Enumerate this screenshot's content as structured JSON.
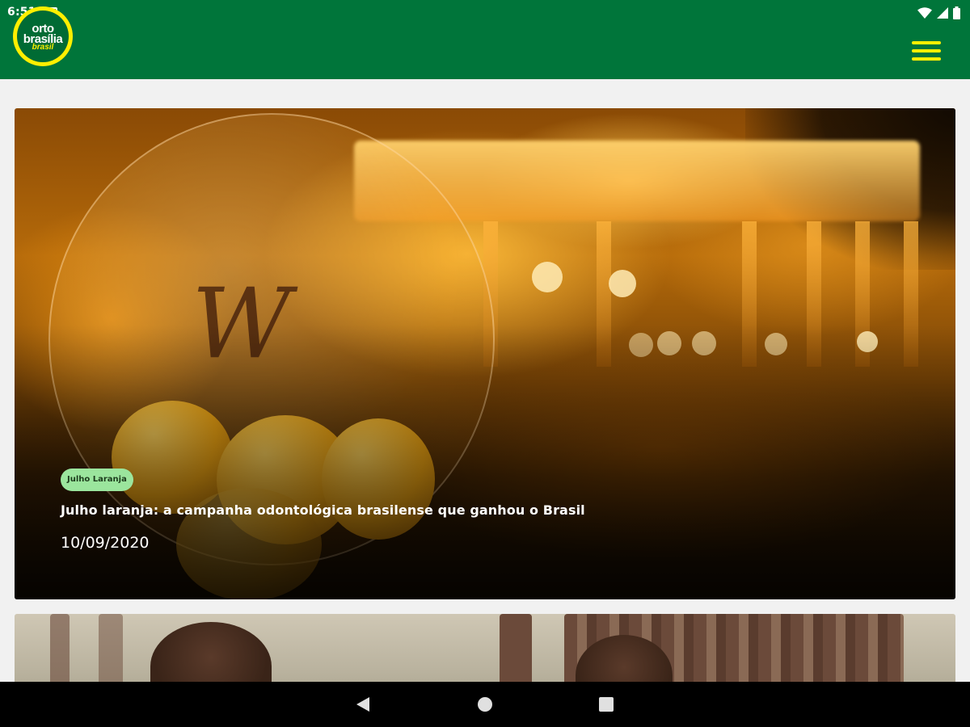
{
  "status_bar": {
    "time": "6:51",
    "icons": [
      "notification-icon",
      "wifi-icon",
      "signal-icon",
      "battery-icon"
    ]
  },
  "app_bar": {
    "logo": {
      "line1": "orto",
      "line2": "brasília",
      "line3": "brasil"
    },
    "menu_icon": "hamburger-menu-icon"
  },
  "feed": {
    "posts": [
      {
        "category": "Julho Laranja",
        "title": "Julho laranja: a campanha odontológica brasilense que ganhou o Brasil",
        "date": "10/09/2020"
      }
    ]
  },
  "nav_bar": {
    "icons": [
      "back-icon",
      "home-icon",
      "recents-icon"
    ]
  },
  "colors": {
    "primary": "#00753a",
    "accent": "#ffef00",
    "badge_bg": "#9be59d",
    "background": "#f1f1f1"
  }
}
